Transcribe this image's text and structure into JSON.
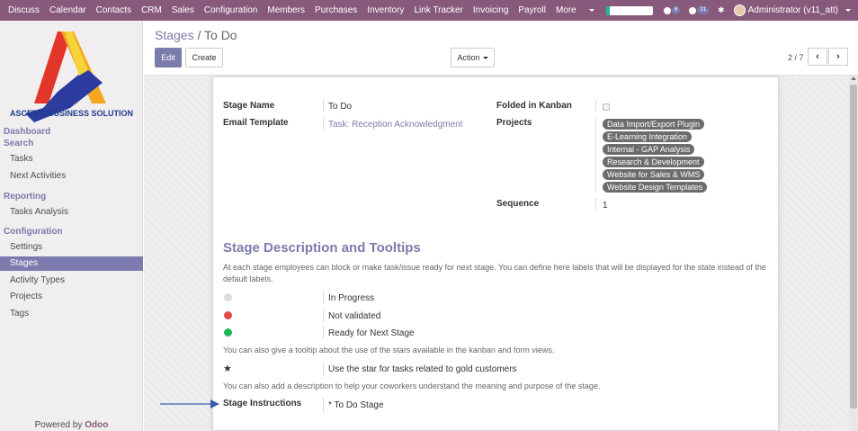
{
  "nav": {
    "menus": [
      "Discuss",
      "Calendar",
      "Contacts",
      "CRM",
      "Sales",
      "Configuration",
      "Members",
      "Purchases",
      "Inventory",
      "Link Tracker",
      "Invoicing",
      "Payroll",
      "More"
    ],
    "messages_count": "6",
    "activities_count": "21",
    "user": "Administrator (v11_att)",
    "progress_fraction": 0.08
  },
  "sidebar": {
    "brand": "ASCETIC BUSINESS SOLUTION",
    "dashboard": "Dashboard",
    "search_header": "Search",
    "search_items": [
      "Tasks",
      "Next Activities"
    ],
    "reporting_header": "Reporting",
    "reporting_items": [
      "Tasks Analysis"
    ],
    "config_header": "Configuration",
    "config_items": [
      "Settings",
      "Stages",
      "Activity Types",
      "Projects",
      "Tags"
    ],
    "active_item": "Stages",
    "powered_by": "Powered by",
    "powered_brand": "Odoo"
  },
  "control": {
    "breadcrumb_parent": "Stages",
    "breadcrumb_sep": "/",
    "breadcrumb_current": "To Do",
    "edit_label": "Edit",
    "create_label": "Create",
    "action_label": "Action",
    "pager": "2 / 7",
    "prev_icon": "‹",
    "next_icon": "›"
  },
  "form": {
    "stage_name_label": "Stage Name",
    "stage_name": "To Do",
    "email_template_label": "Email Template",
    "email_template": "Task: Reception Acknowledgment",
    "folded_label": "Folded in Kanban",
    "projects_label": "Projects",
    "projects": [
      "Data Import/Export Plugin",
      "E-Learning Integration",
      "Internal - GAP Analysis",
      "Research & Development",
      "Website for Sales & WMS",
      "Website Design Templates"
    ],
    "sequence_label": "Sequence",
    "sequence": "1",
    "section_title": "Stage Description and Tooltips",
    "help_states": "At each stage employees can block or make task/issue ready for next stage. You can define here labels that will be displayed for the state instead of the default labels.",
    "state_normal": "In Progress",
    "state_blocked": "Not validated",
    "state_done": "Ready for Next Stage",
    "help_star": "You can also give a tooltip about the use of the stars available in the kanban and form views.",
    "star_label": "Use the star for tasks related to gold customers",
    "help_description": "You can also add a description to help your coworkers understand the meaning and purpose of the stage.",
    "instructions_label": "Stage Instructions",
    "instructions": "* To Do Stage"
  },
  "colors": {
    "brand": "#875a7b",
    "accent": "#7c7bad",
    "dot_grey": "#dddddd",
    "dot_red": "#e64a4a",
    "dot_green": "#21b558"
  }
}
